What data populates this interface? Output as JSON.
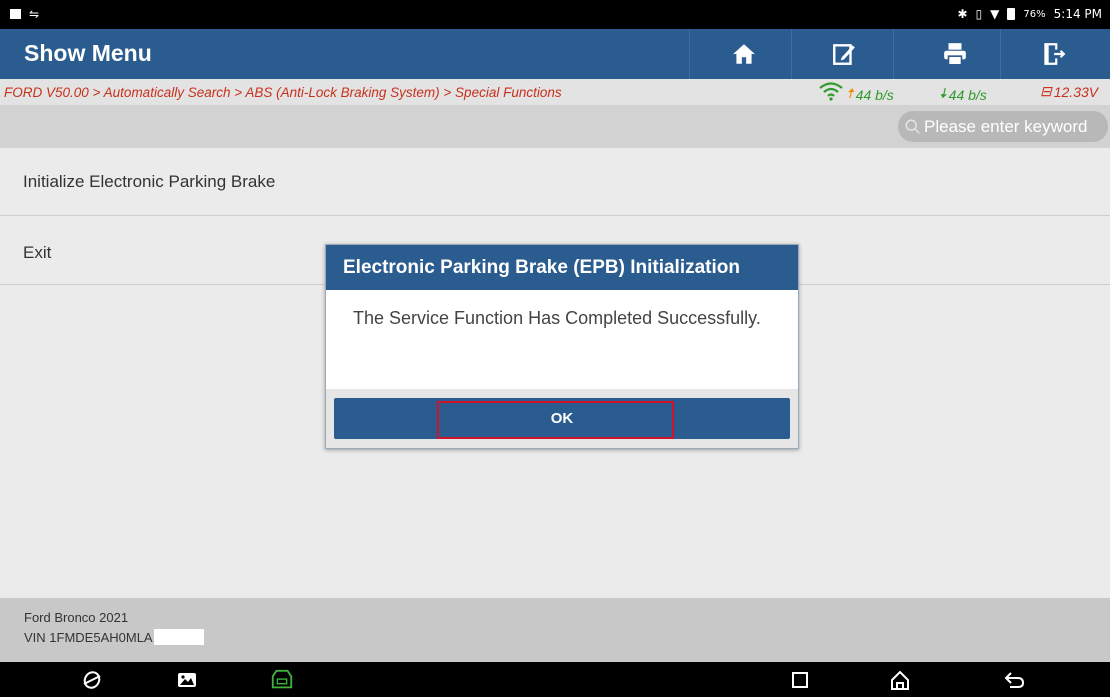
{
  "status_bar": {
    "battery": "76%",
    "time": "5:14 PM"
  },
  "header": {
    "title": "Show Menu",
    "buttons": [
      "home-icon",
      "edit-report-icon",
      "print-icon",
      "exit-icon"
    ]
  },
  "breadcrumb": {
    "path": "FORD V50.00 > Automatically Search > ABS (Anti-Lock Braking System) > Special Functions",
    "upload_rate": "44 b/s",
    "download_rate": "44 b/s",
    "voltage": "12.33V"
  },
  "search": {
    "placeholder": "Please enter keyword"
  },
  "menu": {
    "items": [
      {
        "label": "Initialize Electronic Parking Brake"
      },
      {
        "label": "Exit"
      }
    ]
  },
  "footer": {
    "vehicle": "Ford Bronco 2021",
    "vin": "VIN 1FMDE5AH0MLA"
  },
  "dialog": {
    "title": "Electronic Parking Brake (EPB) Initialization",
    "message": "The Service Function Has Completed Successfully.",
    "ok_label": "OK"
  },
  "colors": {
    "header_blue": "#2b5c8f",
    "breadcrumb_red": "#c8311c",
    "rate_green": "#2f9a2a",
    "upload_orange": "#f08c00",
    "highlight_red": "#d0122a"
  }
}
